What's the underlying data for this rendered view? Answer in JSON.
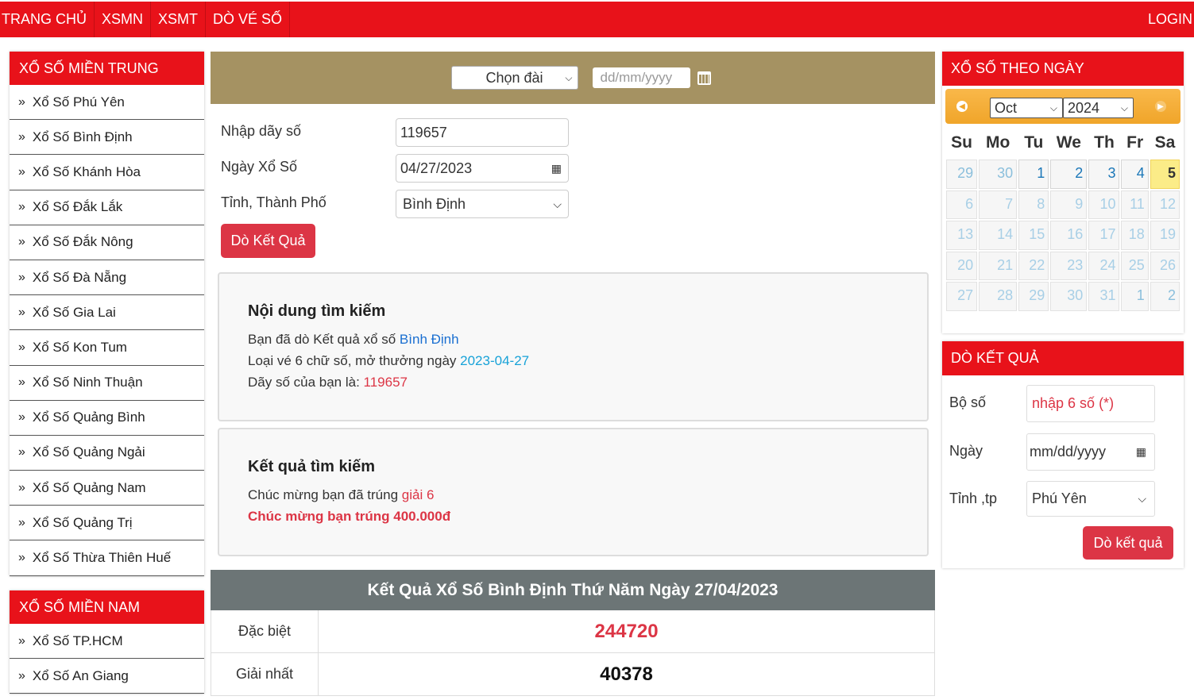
{
  "nav": {
    "items": [
      "TRANG CHỦ",
      "XSMN",
      "XSMT",
      "DÒ VÉ SỐ"
    ],
    "login": "LOGIN"
  },
  "left": {
    "mien_trung": {
      "title": "XỔ SỐ MIỀN TRUNG",
      "items": [
        "Xổ Số Phú Yên",
        "Xổ Số Bình Định",
        "Xổ Số Khánh Hòa",
        "Xổ Số Đắk Lắk",
        "Xổ Số Đắk Nông",
        "Xổ Số Đà Nẵng",
        "Xổ Số Gia Lai",
        "Xổ Số Kon Tum",
        "Xổ Số Ninh Thuận",
        "Xổ Số Quảng Bình",
        "Xổ Số Quảng Ngải",
        "Xổ Số Quảng Nam",
        "Xổ Số Quảng Trị",
        "Xổ Số Thừa Thiên Huế"
      ]
    },
    "mien_nam": {
      "title": "XỔ SỐ MIỀN NAM",
      "items": [
        "Xổ Số TP.HCM",
        "Xổ Số An Giang"
      ]
    }
  },
  "filter": {
    "station_select": "Chọn đài",
    "date_placeholder": "dd/mm/yyyy"
  },
  "form": {
    "number_label": "Nhập dãy số",
    "number_value": "119657",
    "date_label": "Ngày Xổ Số",
    "date_value": "04/27/2023",
    "province_label": "Tỉnh, Thành Phố",
    "province_value": "Bình Định",
    "submit": "Dò Kết Quả"
  },
  "search_content": {
    "title": "Nội dung tìm kiếm",
    "line1_prefix": "Bạn đã dò Kết quả xổ số ",
    "line1_value": "Bình Định",
    "line2_prefix": "Loại vé 6 chữ số, mở thưởng ngày ",
    "line2_value": "2023-04-27",
    "line3_prefix": "Dãy số của bạn là: ",
    "line3_value": "119657"
  },
  "search_result": {
    "title": "Kết quả tìm kiếm",
    "line1_prefix": "Chúc mừng bạn đã trúng ",
    "line1_value": "giải 6",
    "line2": "Chúc mừng bạn trúng 400.000đ"
  },
  "results": {
    "title": "Kết Quả Xổ Số Bình Định Thứ Năm Ngày 27/04/2023",
    "rows": [
      {
        "label": "Đặc biệt",
        "value": "244720"
      },
      {
        "label": "Giải nhất",
        "value": "40378"
      }
    ]
  },
  "calendar": {
    "title": "XỔ SỐ THEO NGÀY",
    "month": "Oct",
    "year": "2024",
    "weekdays": [
      "Su",
      "Mo",
      "Tu",
      "We",
      "Th",
      "Fr",
      "Sa"
    ],
    "weeks": [
      [
        "29",
        "30",
        "1",
        "2",
        "3",
        "4",
        "5"
      ],
      [
        "6",
        "7",
        "8",
        "9",
        "10",
        "11",
        "12"
      ],
      [
        "13",
        "14",
        "15",
        "16",
        "17",
        "18",
        "19"
      ],
      [
        "20",
        "21",
        "22",
        "23",
        "24",
        "25",
        "26"
      ],
      [
        "27",
        "28",
        "29",
        "30",
        "31",
        "1",
        "2"
      ]
    ],
    "today": "5"
  },
  "quick_check": {
    "title": "DÒ KẾT QUẢ",
    "set_label": "Bộ số",
    "set_placeholder": "nhập 6 số (*)",
    "date_label": "Ngày",
    "date_placeholder": "mm/dd/yyyy",
    "province_label": "Tỉnh ,tp",
    "province_value": "Phú Yên",
    "submit": "Dò kết quả"
  },
  "colors": {
    "brand_red": "#e8121a",
    "filter_bar": "#a59262",
    "result_header": "#6c7576",
    "calendar_header": "#f0a52a"
  }
}
